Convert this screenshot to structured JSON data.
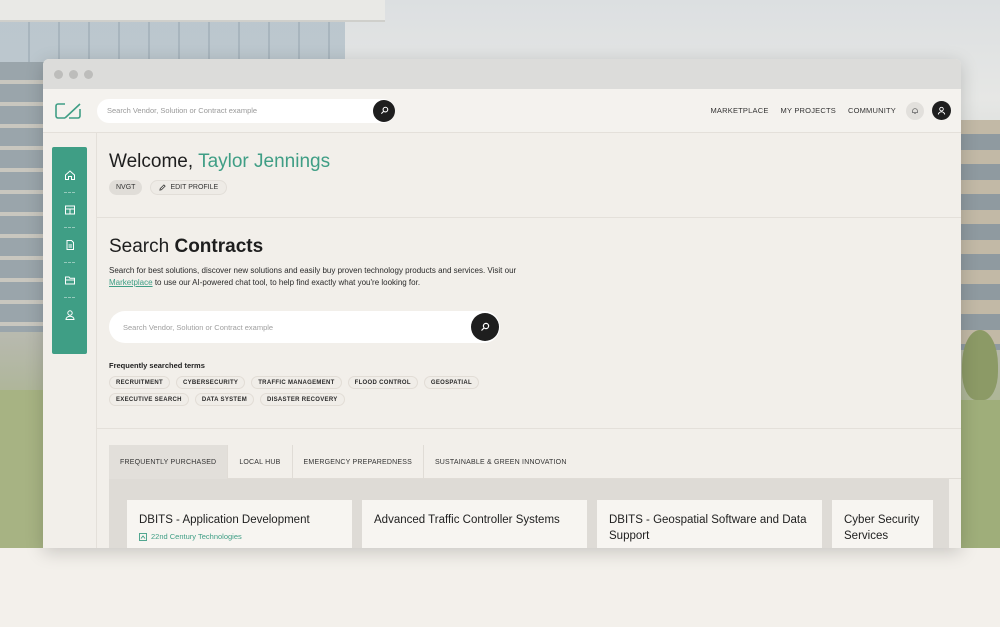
{
  "colors": {
    "accent": "#3f9e85",
    "dark": "#1e1e1e",
    "background": "#f2efea"
  },
  "header": {
    "search_placeholder": "Search Vendor, Solution or Contract example",
    "nav": [
      "MARKETPLACE",
      "MY PROJECTS",
      "COMMUNITY"
    ],
    "icons": {
      "logo": "brand-logo-icon",
      "search": "search-icon",
      "bell": "bell-icon",
      "avatar": "user-icon"
    }
  },
  "sidebar": {
    "items": [
      {
        "icon": "home-icon"
      },
      {
        "icon": "catalog-icon"
      },
      {
        "icon": "document-icon"
      },
      {
        "icon": "folder-icon"
      },
      {
        "icon": "user-icon"
      }
    ]
  },
  "welcome": {
    "greeting": "Welcome,",
    "name": "Taylor Jennings",
    "badge": "NVGT",
    "edit_label": "EDIT PROFILE"
  },
  "search_contracts": {
    "title_light": "Search",
    "title_bold": "Contracts",
    "desc_1": "Search for best solutions, discover new solutions and easily buy proven technology products and services. Visit our",
    "link": "Marketplace",
    "desc_2": "to use our AI-powered chat tool, to help find exactly what you're looking for.",
    "placeholder": "Search Vendor, Solution or Contract example",
    "freq_label": "Frequently searched terms",
    "tags": [
      "RECRUITMENT",
      "CYBERSECURITY",
      "TRAFFIC MANAGEMENT",
      "FLOOD CONTROL",
      "GEOSPATIAL",
      "EXECUTIVE SEARCH",
      "DATA SYSTEM",
      "DISASTER RECOVERY"
    ]
  },
  "tabs": [
    "FREQUENTLY PURCHASED",
    "LOCAL HUB",
    "EMERGENCY PREPAREDNESS",
    "SUSTAINABLE & GREEN INNOVATION"
  ],
  "cards": [
    {
      "title": "DBITS - Application Development",
      "vendor": "22nd Century Technologies"
    },
    {
      "title": "Advanced Traffic Controller Systems",
      "vendor": ""
    },
    {
      "title": "DBITS - Geospatial Software and Data Support",
      "vendor": ""
    },
    {
      "title": "Cyber Security Services",
      "vendor": ""
    }
  ]
}
